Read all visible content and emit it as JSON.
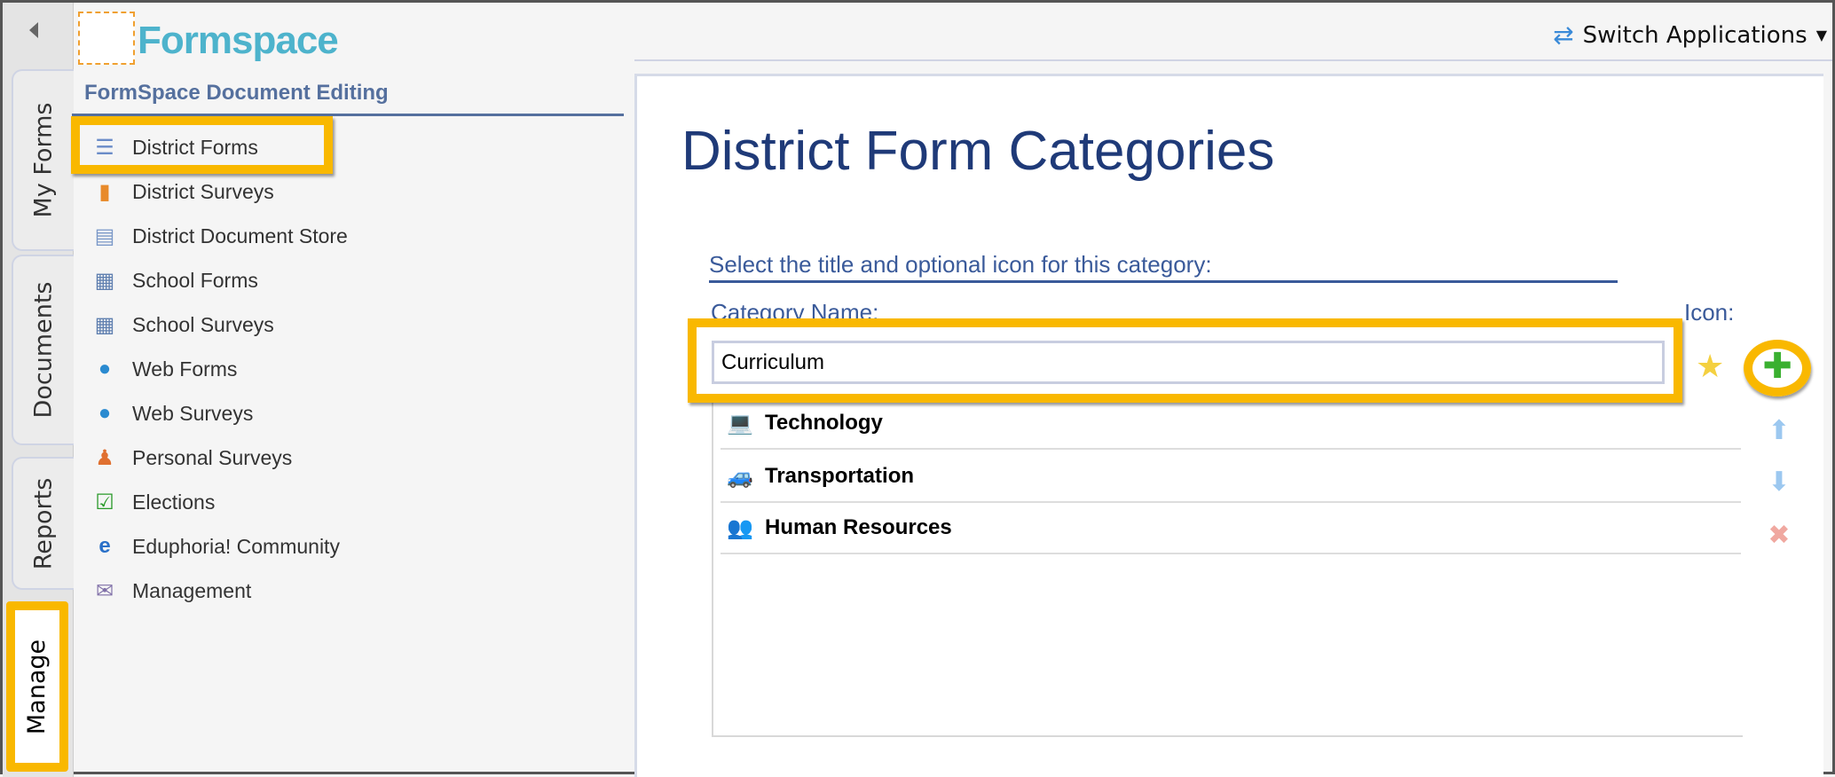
{
  "app": {
    "logo_text": "Formspace",
    "switch_label": "Switch Applications"
  },
  "tabs": [
    {
      "label": "My Forms"
    },
    {
      "label": "Documents"
    },
    {
      "label": "Reports"
    },
    {
      "label": "Manage"
    }
  ],
  "sidebar": {
    "title": "FormSpace Document Editing",
    "items": [
      {
        "label": "District Forms",
        "icon": "form-icon"
      },
      {
        "label": "District Surveys",
        "icon": "clipboard-icon"
      },
      {
        "label": "District Document Store",
        "icon": "document-icon"
      },
      {
        "label": "School Forms",
        "icon": "building-icon"
      },
      {
        "label": "School Surveys",
        "icon": "building-survey-icon"
      },
      {
        "label": "Web Forms",
        "icon": "globe-icon"
      },
      {
        "label": "Web Surveys",
        "icon": "globe-user-icon"
      },
      {
        "label": "Personal Surveys",
        "icon": "person-icon"
      },
      {
        "label": "Elections",
        "icon": "checkbox-icon"
      },
      {
        "label": "Eduphoria! Community",
        "icon": "eduphoria-icon"
      },
      {
        "label": "Management",
        "icon": "mailbox-icon"
      }
    ]
  },
  "main": {
    "title": "District Form Categories",
    "subtitle": "Select the title and optional icon for this category:",
    "category_label": "Category Name:",
    "icon_label": "Icon:",
    "category_value": "Curriculum",
    "categories": [
      {
        "label": "Technology",
        "icon": "laptop-icon"
      },
      {
        "label": "Transportation",
        "icon": "car-icon"
      },
      {
        "label": "Human Resources",
        "icon": "people-icon"
      }
    ]
  },
  "colors": {
    "highlight": "#f9b800",
    "title": "#1f3a78",
    "accent": "#3a5a9a"
  }
}
